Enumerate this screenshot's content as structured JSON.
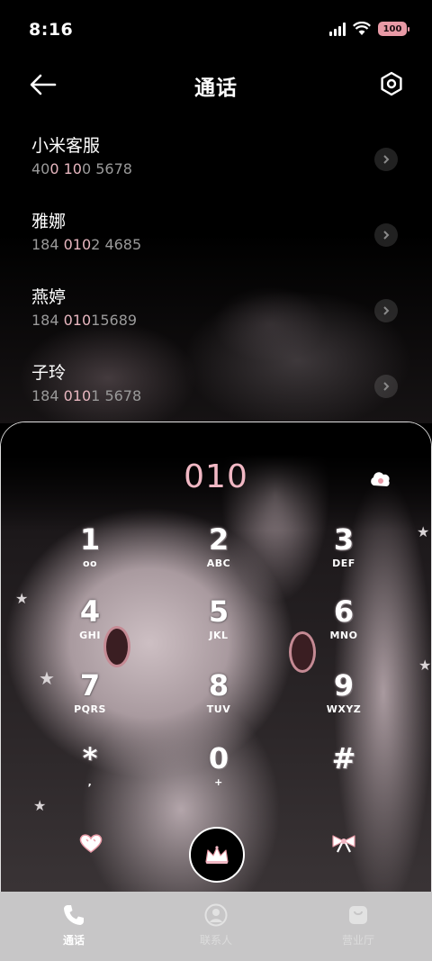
{
  "status": {
    "time": "8:16",
    "battery": "100"
  },
  "header": {
    "title": "通话"
  },
  "contacts": [
    {
      "name": "小米客服",
      "num_a": "40",
      "num_b": "0 10",
      "num_c": "0 5678"
    },
    {
      "name": "雅娜",
      "num_a": "184 ",
      "num_b": "010",
      "num_c": "2 4685"
    },
    {
      "name": "燕婷",
      "num_a": "184 ",
      "num_b": "010",
      "num_c": "15689"
    },
    {
      "name": "子玲",
      "num_a": "184 ",
      "num_b": "010",
      "num_c": "1 5678"
    }
  ],
  "dialer": {
    "number": "010",
    "keys": [
      {
        "digit": "1",
        "letters": "ᴏᴏ"
      },
      {
        "digit": "2",
        "letters": "ABC"
      },
      {
        "digit": "3",
        "letters": "DEF"
      },
      {
        "digit": "4",
        "letters": "GHI"
      },
      {
        "digit": "5",
        "letters": "JKL"
      },
      {
        "digit": "6",
        "letters": "MNO"
      },
      {
        "digit": "7",
        "letters": "PQRS"
      },
      {
        "digit": "8",
        "letters": "TUV"
      },
      {
        "digit": "9",
        "letters": "WXYZ"
      },
      {
        "digit": "*",
        "letters": ","
      },
      {
        "digit": "0",
        "letters": "+"
      },
      {
        "digit": "#",
        "letters": ""
      }
    ]
  },
  "tabs": [
    {
      "label": "通话",
      "icon": "phone-icon"
    },
    {
      "label": "联系人",
      "icon": "person-icon"
    },
    {
      "label": "营业厅",
      "icon": "shopping-bag-icon"
    }
  ],
  "colors": {
    "accent_pink": "#f1b8c4",
    "battery_pink": "#e89aa6",
    "tabbar_bg": "#c7c6c7"
  }
}
